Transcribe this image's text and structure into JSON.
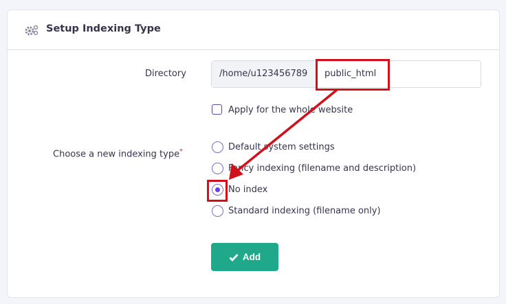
{
  "header": {
    "title": "Setup Indexing Type",
    "icon": "gears-icon"
  },
  "form": {
    "directory_label": "Directory",
    "directory_prefix": "/home/u123456789",
    "directory_value": "public_html",
    "apply_whole_label": "Apply for the whole website",
    "apply_whole_checked": false,
    "indexing_label": "Choose a new indexing type",
    "required_mark": "*",
    "options": [
      {
        "label": "Default system settings",
        "selected": false
      },
      {
        "label": "Fancy indexing (filename and description)",
        "selected": false
      },
      {
        "label": "No index",
        "selected": true
      },
      {
        "label": "Standard indexing (filename only)",
        "selected": false
      }
    ],
    "add_label": "Add"
  },
  "colors": {
    "accent": "#673de6",
    "button": "#1fa98a",
    "annotation": "#d0101a"
  }
}
